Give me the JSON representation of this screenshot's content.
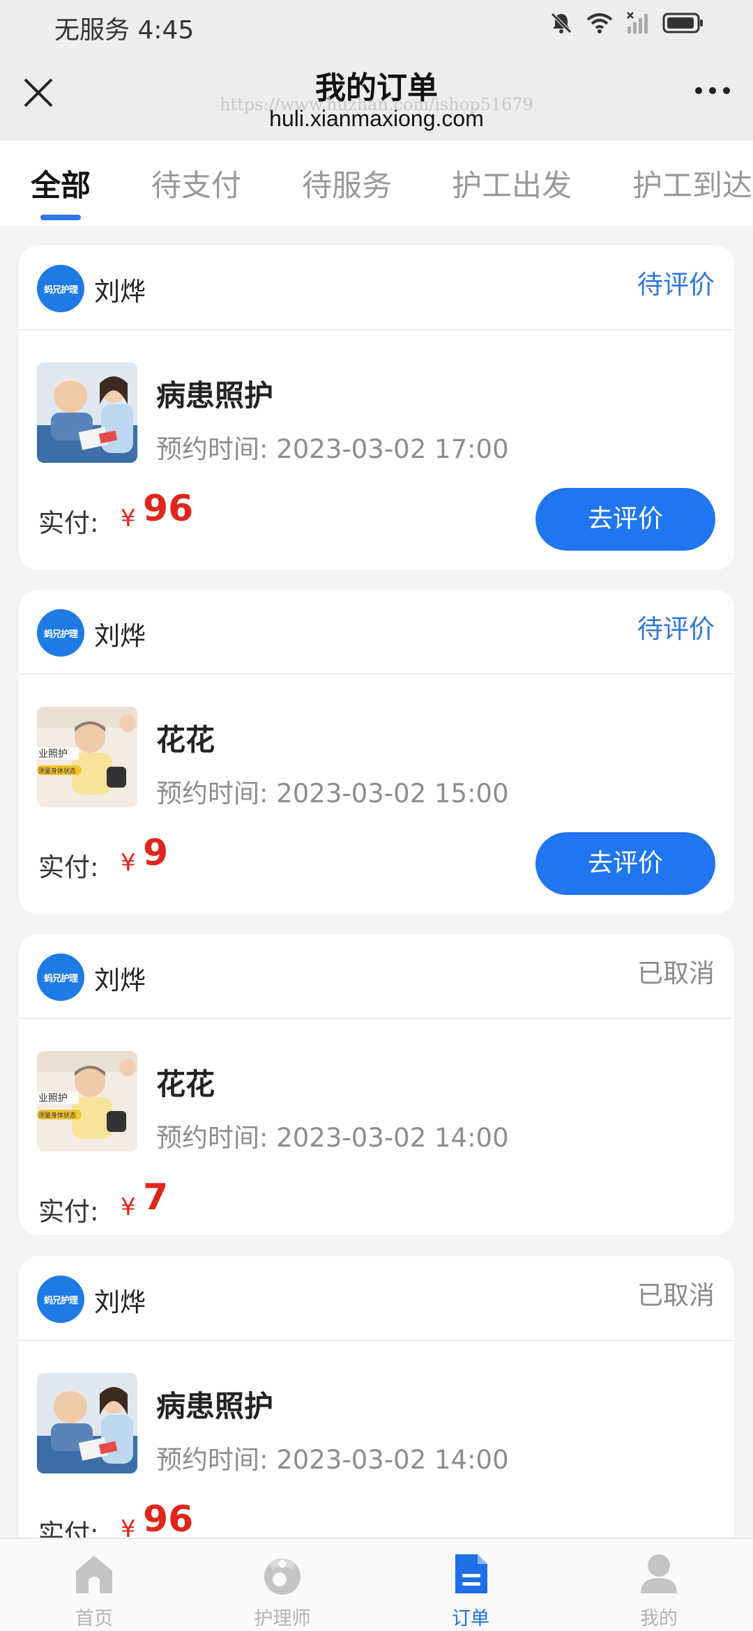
{
  "status_bar": {
    "carrier_time": "无服务 4:45"
  },
  "header": {
    "title": "我的订单",
    "watermark": "https://www.huzhan.com/ishop51679",
    "domain": "huli.xianmaxiong.com"
  },
  "tabs": [
    "全部",
    "待支付",
    "待服务",
    "护工出发",
    "护工到达"
  ],
  "brand_logo_text": "蚂兄护理",
  "paid_label": "实付:",
  "currency": "¥",
  "time_prefix": "预约时间:",
  "orders": [
    {
      "nurse": "刘烨",
      "status": "待评价",
      "service": "病患照护",
      "time": "预约时间: 2023-03-02 17:00",
      "amount": "96",
      "action": "去评价",
      "thumb": "elder-man-care-photo"
    },
    {
      "nurse": "刘烨",
      "status": "待评价",
      "service": "花花",
      "time": "预约时间: 2023-03-02 15:00",
      "amount": "9",
      "action": "去评价",
      "thumb": "elder-woman-bloodpressure-photo"
    },
    {
      "nurse": "刘烨",
      "status": "已取消",
      "service": "花花",
      "time": "预约时间: 2023-03-02 14:00",
      "amount": "7",
      "thumb": "elder-woman-bloodpressure-photo"
    },
    {
      "nurse": "刘烨",
      "status": "已取消",
      "service": "病患照护",
      "time": "预约时间: 2023-03-02 14:00",
      "amount": "96",
      "thumb": "elder-man-care-photo"
    }
  ],
  "thumb_text": {
    "line1": "业照护",
    "line2": "测量身体状态"
  },
  "bottom_nav": [
    {
      "label": "首页",
      "icon": "home-icon",
      "active": false
    },
    {
      "label": "护理师",
      "icon": "nurse-icon",
      "active": false
    },
    {
      "label": "订单",
      "icon": "order-document-icon",
      "active": true
    },
    {
      "label": "我的",
      "icon": "profile-icon",
      "active": false
    }
  ],
  "colors": {
    "accent": "#1f76f0",
    "price": "#e0251b",
    "status_pending": "#2f76d8",
    "status_cancelled": "#8a8a8a"
  }
}
